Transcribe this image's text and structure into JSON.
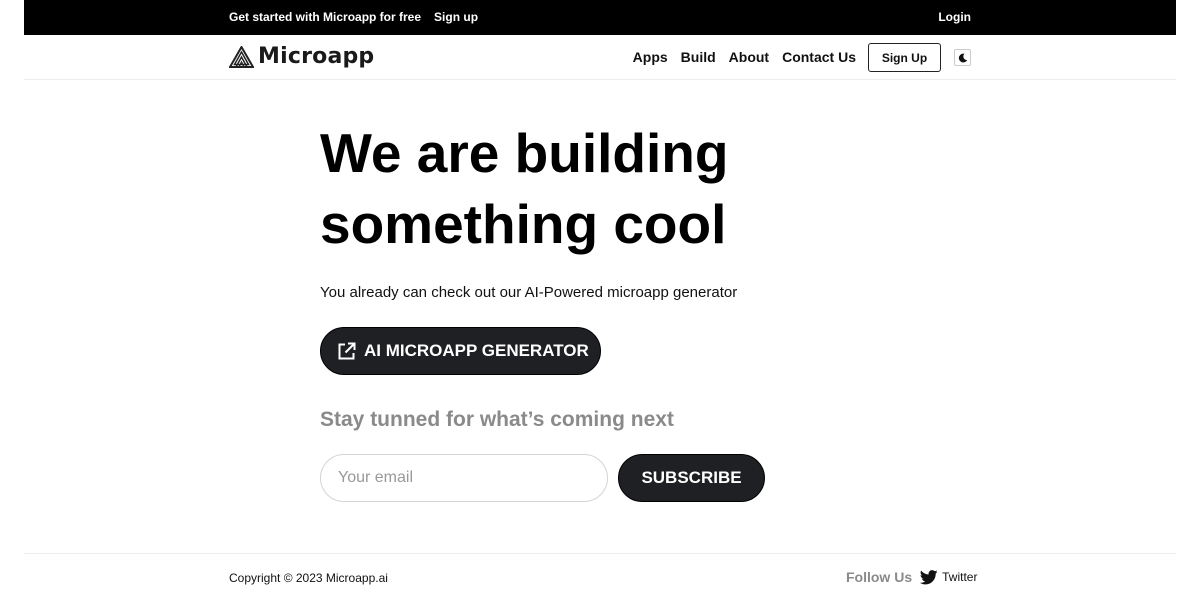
{
  "topbar": {
    "promo_text": "Get started with Microapp for free",
    "signup_link": "Sign up",
    "login_link": "Login"
  },
  "brand": {
    "name": "Microapp",
    "logo_icon": "triangle-logo-icon"
  },
  "nav": {
    "items": [
      {
        "label": "Apps"
      },
      {
        "label": "Build"
      },
      {
        "label": "About"
      },
      {
        "label": "Contact Us"
      }
    ],
    "signup_button": "Sign Up",
    "theme_icon": "moon-icon"
  },
  "hero": {
    "title_line1": "We are building",
    "title_line2": "something cool",
    "subtitle": "You already can check out our AI-Powered microapp generator",
    "cta_label": "AI MICROAPP GENERATOR",
    "cta_icon": "external-link-icon"
  },
  "newsletter": {
    "heading": "Stay tunned for what’s coming next",
    "email_placeholder": "Your email",
    "email_value": "",
    "subscribe_label": "SUBSCRIBE"
  },
  "footer": {
    "copyright": "Copyright © 2023 Microapp.ai",
    "follow_label": "Follow Us",
    "twitter_label": "Twitter",
    "twitter_icon": "twitter-bird-icon"
  },
  "colors": {
    "topbar_bg": "#000000",
    "button_bg": "#1f2023",
    "muted_text": "#8a8a8a",
    "border": "#ececec"
  }
}
